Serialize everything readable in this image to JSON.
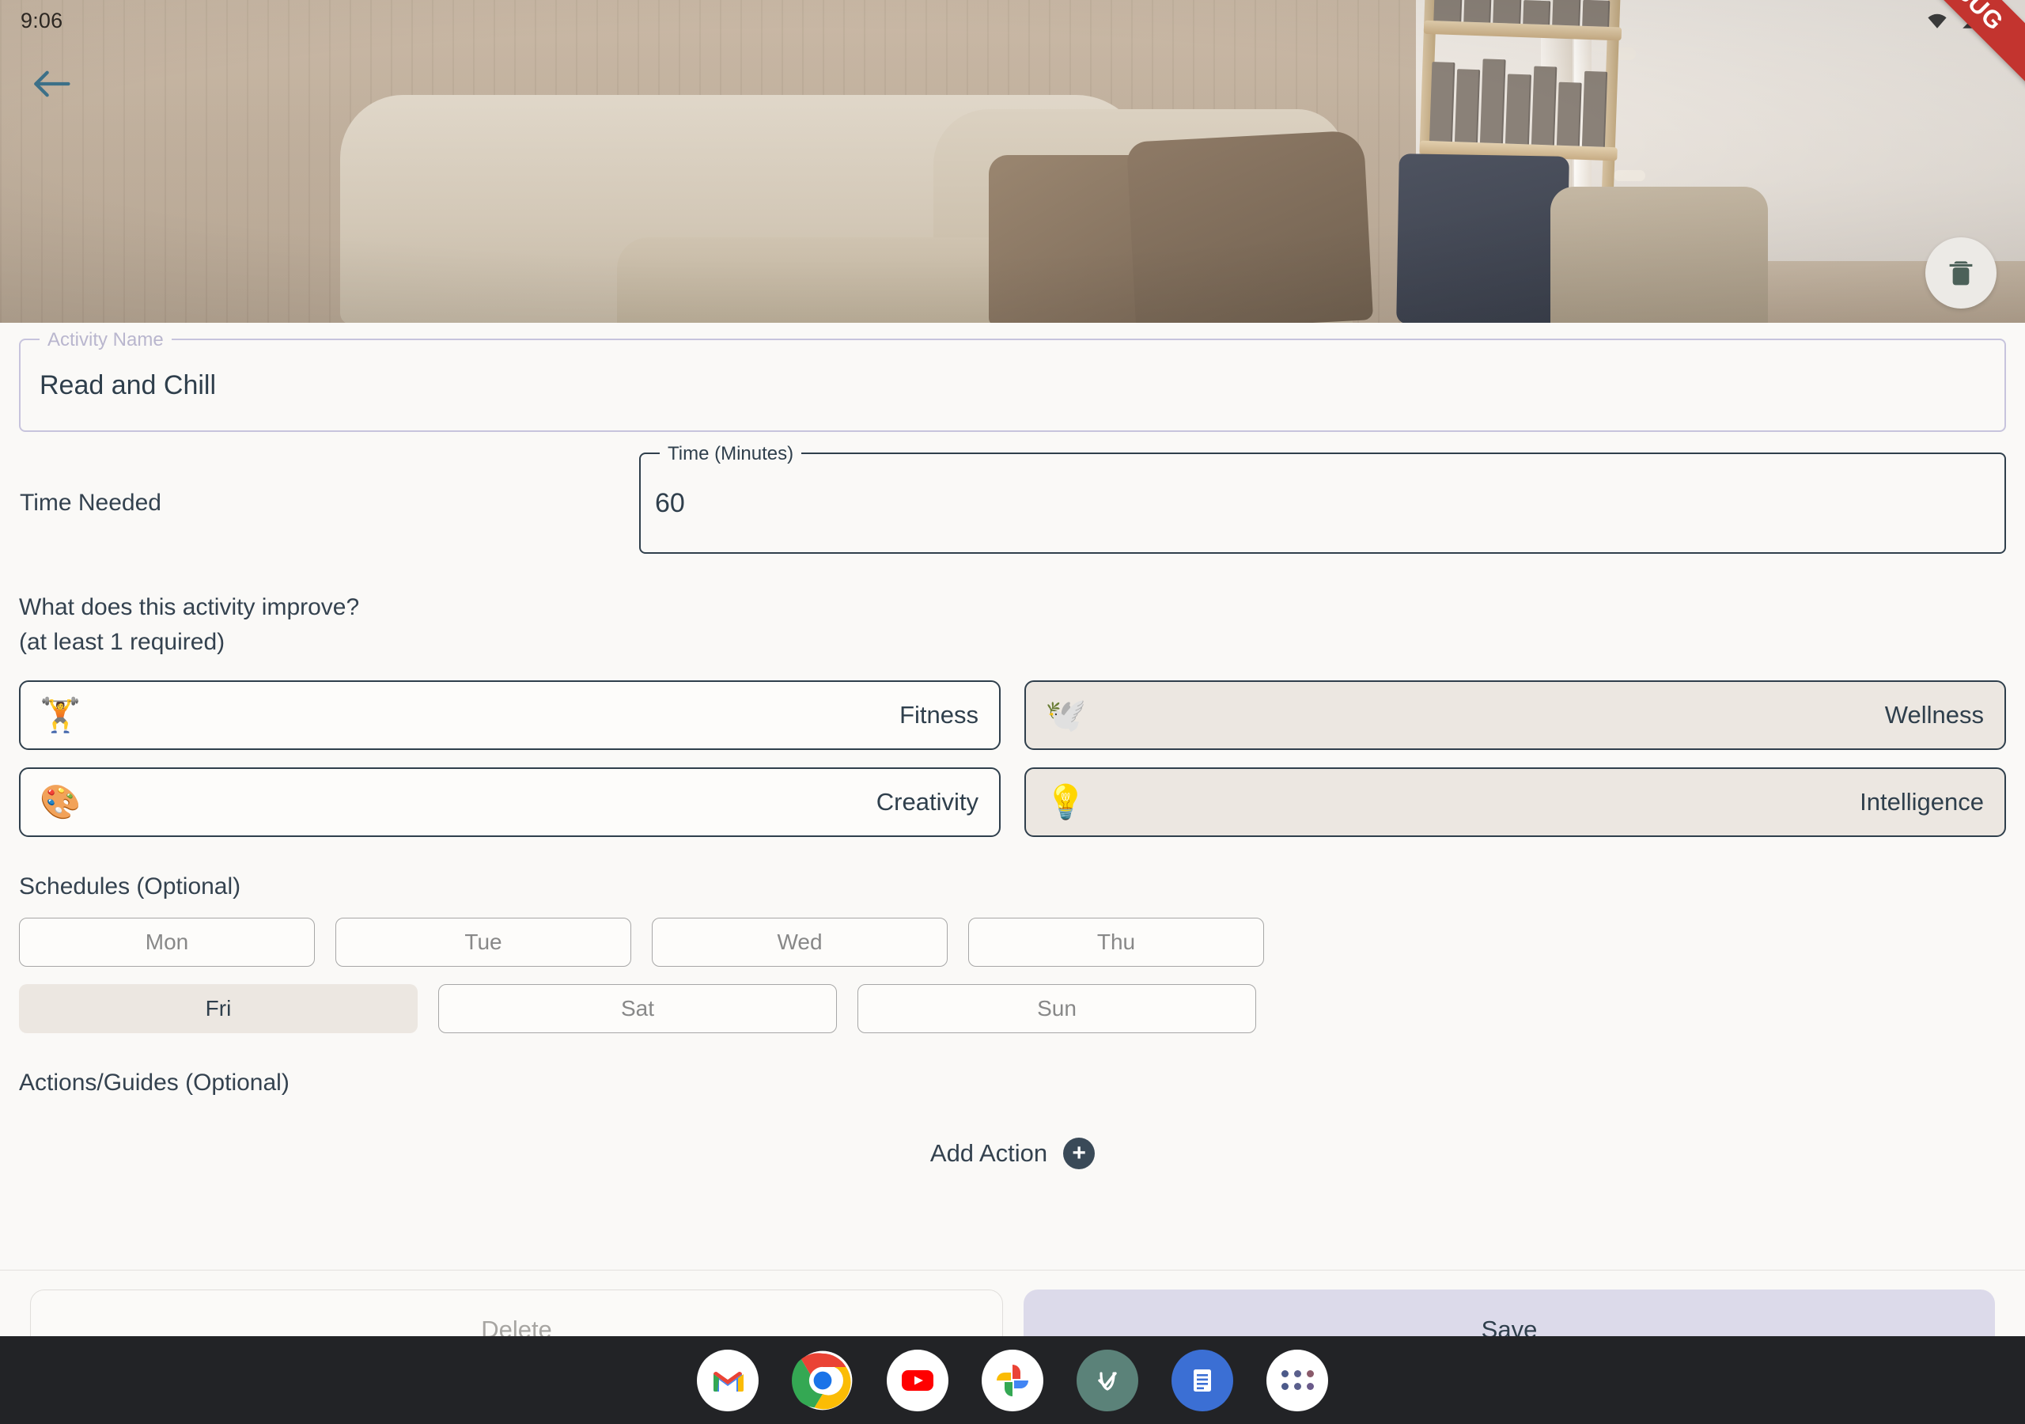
{
  "status_bar": {
    "clock": "9:06",
    "icons": [
      "wifi-icon",
      "cell-signal-icon",
      "battery-icon"
    ]
  },
  "debug_banner": {
    "text": "DEBUG",
    "color": "#c3342f"
  },
  "hero": {
    "alt": "living room photo with beige couch, brown cushions, navy pillow and wooden bookshelf ladder",
    "back_icon": "back-arrow-icon",
    "delete_icon": "trash-icon"
  },
  "form": {
    "activity_name": {
      "label": "Activity Name",
      "value": "Read and Chill",
      "placeholder": "Activity Name",
      "border_color": "#c7c4dd"
    },
    "time_needed": {
      "label": "Time Needed",
      "field_label": "Time (Minutes)",
      "value": "60",
      "placeholder": "Time (Minutes)",
      "border_color": "#2f3f4c"
    },
    "improve_question": {
      "line1": "What does this activity improve?",
      "line2": "(at least 1 required)"
    },
    "attributes": [
      {
        "label": "Fitness",
        "emoji": "🏋️",
        "icon": "dumbbell-icon",
        "selected": false
      },
      {
        "label": "Wellness",
        "emoji": "🕊️",
        "icon": "dove-icon",
        "selected": true
      },
      {
        "label": "Creativity",
        "emoji": "🎨",
        "icon": "art-palette-icon",
        "selected": false
      },
      {
        "label": "Intelligence",
        "emoji": "💡",
        "icon": "lightbulb-icon",
        "selected": true
      }
    ],
    "schedules": {
      "title": "Schedules (Optional)",
      "days_row1": [
        {
          "label": "Mon",
          "selected": false
        },
        {
          "label": "Tue",
          "selected": false
        },
        {
          "label": "Wed",
          "selected": false
        },
        {
          "label": "Thu",
          "selected": false
        }
      ],
      "days_row2": [
        {
          "label": "Fri",
          "selected": true
        },
        {
          "label": "Sat",
          "selected": false
        },
        {
          "label": "Sun",
          "selected": false
        }
      ]
    },
    "actions": {
      "title": "Actions/Guides (Optional)",
      "add_label": "Add Action",
      "add_icon": "plus-circle-icon"
    }
  },
  "bottom_bar": {
    "delete_label": "Delete",
    "save_label": "Save",
    "save_bg": "#dcdaea"
  },
  "taskbar": {
    "apps": [
      {
        "name": "gmail-icon"
      },
      {
        "name": "chrome-icon"
      },
      {
        "name": "youtube-icon"
      },
      {
        "name": "google-photos-icon"
      },
      {
        "name": "habit-check-app-icon"
      },
      {
        "name": "docs-app-icon"
      },
      {
        "name": "app-drawer-icon"
      }
    ]
  },
  "selected_chip_bg": "#ece7e1",
  "page_bg": "#faf9f7",
  "text_color": "#2f3f4c"
}
